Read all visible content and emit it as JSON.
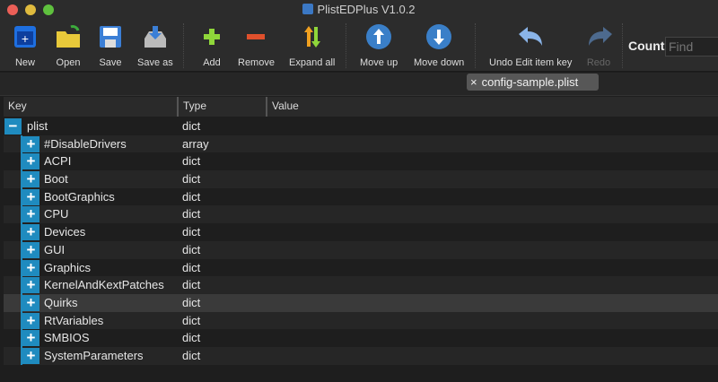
{
  "window": {
    "title": "PlistEDPlus V1.0.2"
  },
  "toolbar": {
    "new": "New",
    "open": "Open",
    "save": "Save",
    "save_as": "Save as",
    "add": "Add",
    "remove": "Remove",
    "expand_all": "Expand all",
    "move_up": "Move up",
    "move_down": "Move down",
    "undo": "Undo Edit item key",
    "redo": "Redo",
    "count": "Count",
    "find_placeholder": "Find"
  },
  "tab": {
    "label": "config-sample.plist",
    "close": "×"
  },
  "columns": {
    "key": "Key",
    "type": "Type",
    "value": "Value"
  },
  "root": {
    "key": "plist",
    "type": "dict",
    "toggle": "−"
  },
  "rows": [
    {
      "key": "#DisableDrivers",
      "type": "array"
    },
    {
      "key": "ACPI",
      "type": "dict"
    },
    {
      "key": "Boot",
      "type": "dict"
    },
    {
      "key": "BootGraphics",
      "type": "dict"
    },
    {
      "key": "CPU",
      "type": "dict"
    },
    {
      "key": "Devices",
      "type": "dict"
    },
    {
      "key": "GUI",
      "type": "dict"
    },
    {
      "key": "Graphics",
      "type": "dict"
    },
    {
      "key": "KernelAndKextPatches",
      "type": "dict"
    },
    {
      "key": "Quirks",
      "type": "dict"
    },
    {
      "key": "RtVariables",
      "type": "dict"
    },
    {
      "key": "SMBIOS",
      "type": "dict"
    },
    {
      "key": "SystemParameters",
      "type": "dict"
    }
  ],
  "expand_symbol": "+",
  "selected_row": "Quirks"
}
